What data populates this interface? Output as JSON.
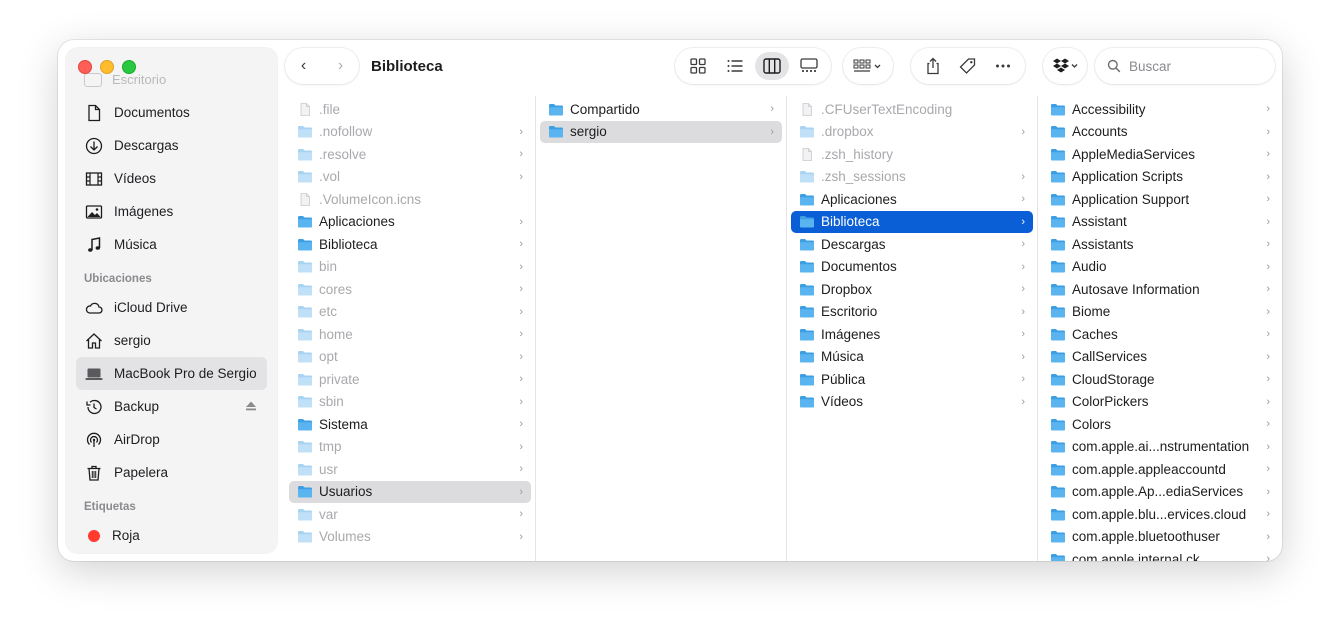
{
  "window": {
    "title": "Biblioteca"
  },
  "sidebar": {
    "ghost_label": "Escritorio",
    "favorites": [
      {
        "label": "Documentos",
        "icon": "document-icon"
      },
      {
        "label": "Descargas",
        "icon": "download-icon"
      },
      {
        "label": "Vídeos",
        "icon": "film-icon"
      },
      {
        "label": "Imágenes",
        "icon": "photo-icon"
      },
      {
        "label": "Música",
        "icon": "music-icon"
      }
    ],
    "locations_header": "Ubicaciones",
    "locations": [
      {
        "label": "iCloud Drive",
        "icon": "cloud-icon"
      },
      {
        "label": "sergio",
        "icon": "home-icon"
      },
      {
        "label": "MacBook Pro de Sergio",
        "icon": "laptop-icon",
        "selected": true
      },
      {
        "label": "Backup",
        "icon": "time-machine-icon",
        "eject": true
      },
      {
        "label": "AirDrop",
        "icon": "airdrop-icon"
      },
      {
        "label": "Papelera",
        "icon": "trash-icon"
      }
    ],
    "tags_header": "Etiquetas",
    "tags": [
      {
        "label": "Roja",
        "color": "#ff3b30"
      }
    ]
  },
  "toolbar": {
    "back": "‹",
    "forward": "›",
    "search_placeholder": "Buscar",
    "search_value": ""
  },
  "columns": [
    {
      "items": [
        {
          "name": ".file",
          "type": "file",
          "dim": true,
          "chevron": false
        },
        {
          "name": ".nofollow",
          "type": "folder",
          "dim": true,
          "chevron": true
        },
        {
          "name": ".resolve",
          "type": "folder",
          "dim": true,
          "chevron": true
        },
        {
          "name": ".vol",
          "type": "folder",
          "dim": true,
          "chevron": true
        },
        {
          "name": ".VolumeIcon.icns",
          "type": "file",
          "dim": true,
          "chevron": false
        },
        {
          "name": "Aplicaciones",
          "type": "folder",
          "dim": false,
          "chevron": true
        },
        {
          "name": "Biblioteca",
          "type": "folder",
          "dim": false,
          "chevron": true
        },
        {
          "name": "bin",
          "type": "folder",
          "dim": true,
          "chevron": true
        },
        {
          "name": "cores",
          "type": "folder",
          "dim": true,
          "chevron": true
        },
        {
          "name": "etc",
          "type": "folder",
          "dim": true,
          "chevron": true
        },
        {
          "name": "home",
          "type": "folder",
          "dim": true,
          "chevron": true
        },
        {
          "name": "opt",
          "type": "folder",
          "dim": true,
          "chevron": true
        },
        {
          "name": "private",
          "type": "folder",
          "dim": true,
          "chevron": true
        },
        {
          "name": "sbin",
          "type": "folder",
          "dim": true,
          "chevron": true
        },
        {
          "name": "Sistema",
          "type": "folder",
          "dim": false,
          "chevron": true
        },
        {
          "name": "tmp",
          "type": "folder",
          "dim": true,
          "chevron": true
        },
        {
          "name": "usr",
          "type": "folder",
          "dim": true,
          "chevron": true
        },
        {
          "name": "Usuarios",
          "type": "folder",
          "dim": false,
          "chevron": true,
          "selected": "grey"
        },
        {
          "name": "var",
          "type": "folder",
          "dim": true,
          "chevron": true
        },
        {
          "name": "Volumes",
          "type": "folder",
          "dim": true,
          "chevron": true
        }
      ]
    },
    {
      "items": [
        {
          "name": "Compartido",
          "type": "folder",
          "dim": false,
          "chevron": true
        },
        {
          "name": "sergio",
          "type": "folder",
          "dim": false,
          "chevron": true,
          "selected": "grey"
        }
      ]
    },
    {
      "items": [
        {
          "name": ".CFUserTextEncoding",
          "type": "file",
          "dim": true,
          "chevron": false
        },
        {
          "name": ".dropbox",
          "type": "folder",
          "dim": true,
          "chevron": true
        },
        {
          "name": ".zsh_history",
          "type": "file",
          "dim": true,
          "chevron": false
        },
        {
          "name": ".zsh_sessions",
          "type": "folder",
          "dim": true,
          "chevron": true
        },
        {
          "name": "Aplicaciones",
          "type": "folder",
          "dim": false,
          "chevron": true
        },
        {
          "name": "Biblioteca",
          "type": "folder",
          "dim": false,
          "chevron": true,
          "selected": "blue"
        },
        {
          "name": "Descargas",
          "type": "folder",
          "dim": false,
          "chevron": true
        },
        {
          "name": "Documentos",
          "type": "folder",
          "dim": false,
          "chevron": true
        },
        {
          "name": "Dropbox",
          "type": "folder",
          "dim": false,
          "chevron": true
        },
        {
          "name": "Escritorio",
          "type": "folder",
          "dim": false,
          "chevron": true
        },
        {
          "name": "Imágenes",
          "type": "folder",
          "dim": false,
          "chevron": true
        },
        {
          "name": "Música",
          "type": "folder",
          "dim": false,
          "chevron": true
        },
        {
          "name": "Pública",
          "type": "folder",
          "dim": false,
          "chevron": true
        },
        {
          "name": "Vídeos",
          "type": "folder",
          "dim": false,
          "chevron": true
        }
      ]
    },
    {
      "items": [
        {
          "name": "Accessibility",
          "type": "folder",
          "dim": false,
          "chevron": true
        },
        {
          "name": "Accounts",
          "type": "folder",
          "dim": false,
          "chevron": true
        },
        {
          "name": "AppleMediaServices",
          "type": "folder",
          "dim": false,
          "chevron": true
        },
        {
          "name": "Application Scripts",
          "type": "folder",
          "dim": false,
          "chevron": true
        },
        {
          "name": "Application Support",
          "type": "folder",
          "dim": false,
          "chevron": true
        },
        {
          "name": "Assistant",
          "type": "folder",
          "dim": false,
          "chevron": true
        },
        {
          "name": "Assistants",
          "type": "folder",
          "dim": false,
          "chevron": true
        },
        {
          "name": "Audio",
          "type": "folder",
          "dim": false,
          "chevron": true
        },
        {
          "name": "Autosave Information",
          "type": "folder",
          "dim": false,
          "chevron": true
        },
        {
          "name": "Biome",
          "type": "folder",
          "dim": false,
          "chevron": true
        },
        {
          "name": "Caches",
          "type": "folder",
          "dim": false,
          "chevron": true
        },
        {
          "name": "CallServices",
          "type": "folder",
          "dim": false,
          "chevron": true
        },
        {
          "name": "CloudStorage",
          "type": "folder",
          "dim": false,
          "chevron": true
        },
        {
          "name": "ColorPickers",
          "type": "folder",
          "dim": false,
          "chevron": true
        },
        {
          "name": "Colors",
          "type": "folder",
          "dim": false,
          "chevron": true
        },
        {
          "name": "com.apple.ai...nstrumentation",
          "type": "folder",
          "dim": false,
          "chevron": true
        },
        {
          "name": "com.apple.appleaccountd",
          "type": "folder",
          "dim": false,
          "chevron": true
        },
        {
          "name": "com.apple.Ap...ediaServices",
          "type": "folder",
          "dim": false,
          "chevron": true
        },
        {
          "name": "com.apple.blu...ervices.cloud",
          "type": "folder",
          "dim": false,
          "chevron": true
        },
        {
          "name": "com.apple.bluetoothuser",
          "type": "folder",
          "dim": false,
          "chevron": true
        },
        {
          "name": "com.apple.internal.ck",
          "type": "folder",
          "dim": false,
          "chevron": true
        }
      ]
    }
  ],
  "colors": {
    "accent": "#0a5fd6",
    "folder": "#5ab4ef",
    "folder_dim": "#bfe0f7"
  }
}
